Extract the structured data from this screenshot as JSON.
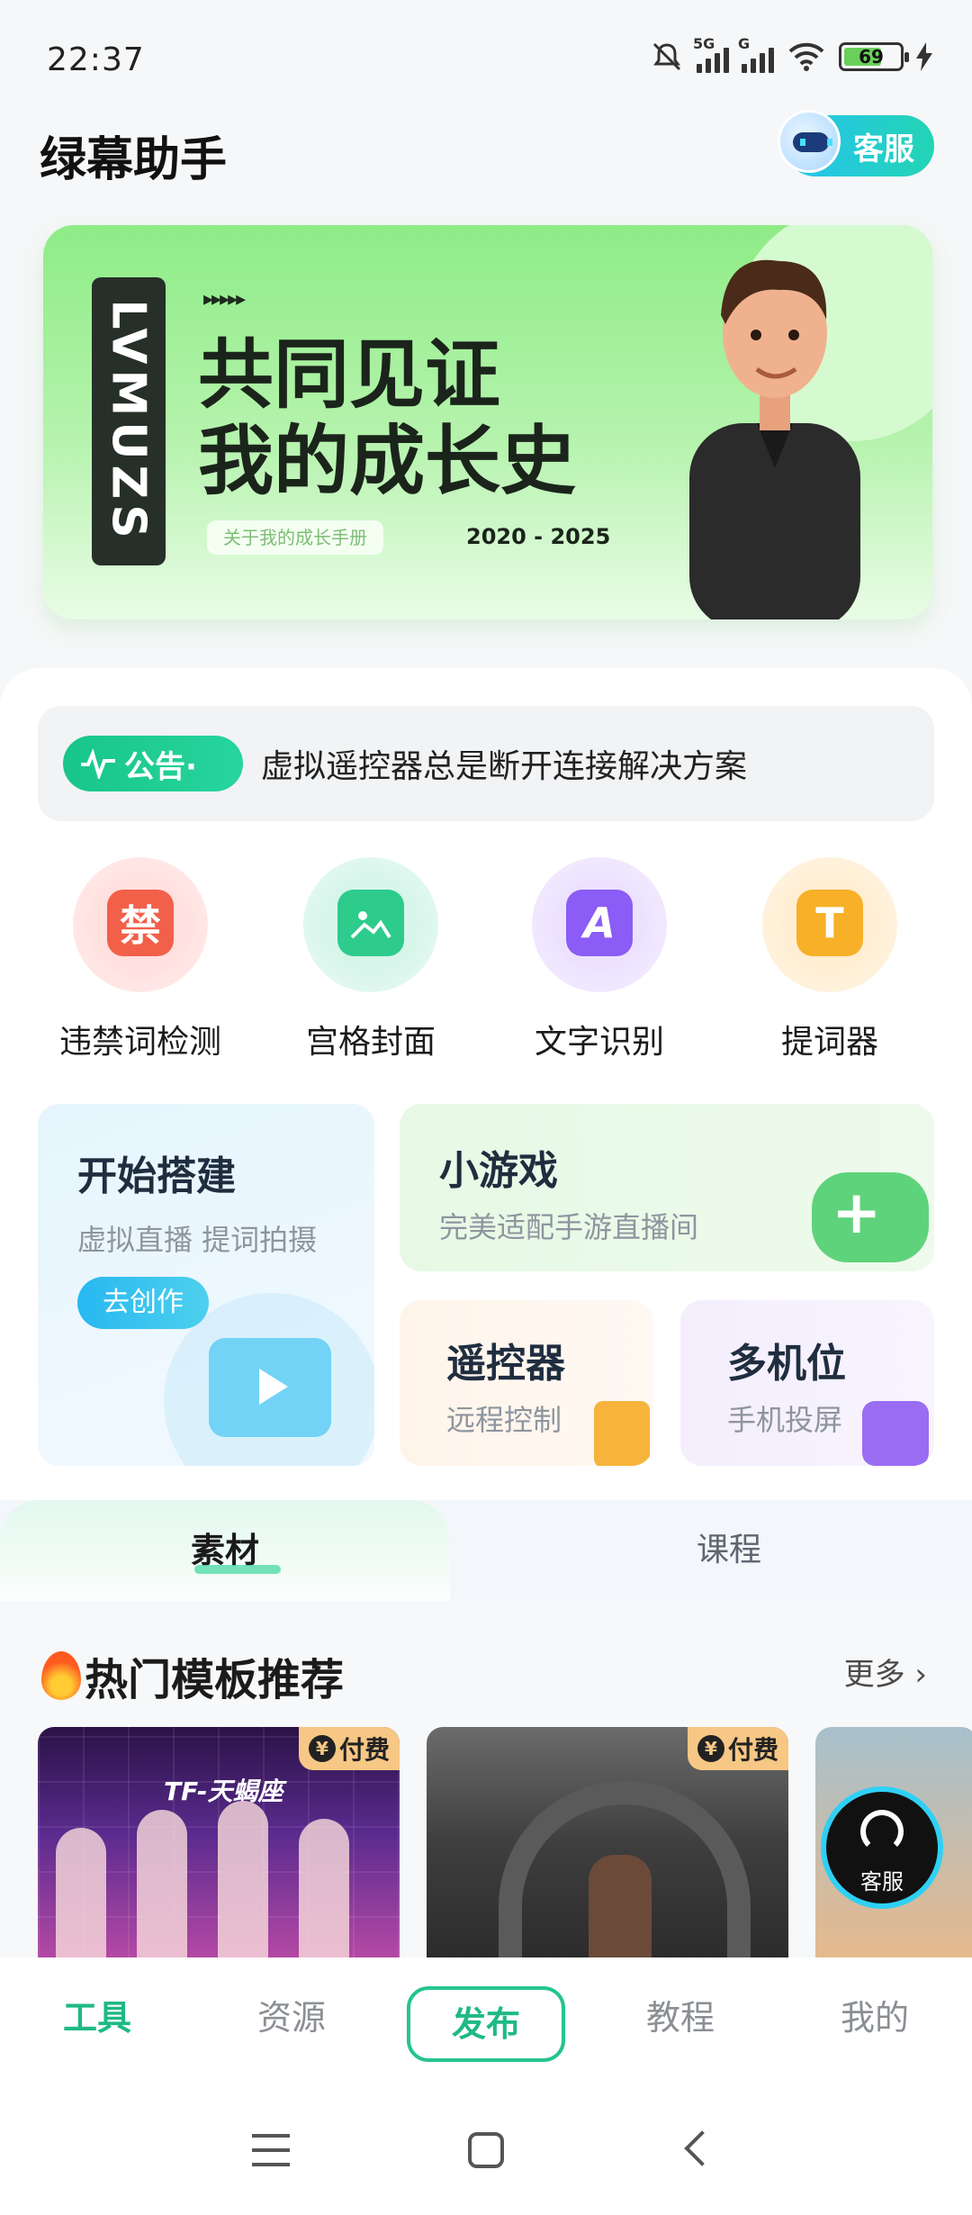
{
  "status": {
    "time": "22:37",
    "battery": "69",
    "network_label_1": "5G",
    "network_label_2": "G"
  },
  "header": {
    "title": "绿幕助手",
    "service_label": "客服"
  },
  "banner": {
    "vertical_tag": "LVMUZS",
    "arrows": "▸▸▸▸▸",
    "headline_line1": "共同见证",
    "headline_line2": "我的成长史",
    "pill": "关于我的成长手册",
    "years": "2020 - 2025"
  },
  "notice": {
    "badge": "公告·",
    "text": "虚拟遥控器总是断开连接解决方案"
  },
  "tools": [
    {
      "label": "违禁词检测",
      "glyph": "禁",
      "icon": "ban-word-icon"
    },
    {
      "label": "宫格封面",
      "glyph": "",
      "icon": "image-icon"
    },
    {
      "label": "文字识别",
      "glyph": "A",
      "icon": "text-recognition-icon"
    },
    {
      "label": "提词器",
      "glyph": "T",
      "icon": "teleprompter-icon"
    }
  ],
  "features": {
    "build": {
      "title": "开始搭建",
      "subtitle": "虚拟直播 提词拍摄",
      "button": "去创作"
    },
    "game": {
      "title": "小游戏",
      "subtitle": "完美适配手游直播间"
    },
    "remote": {
      "title": "遥控器",
      "subtitle": "远程控制"
    },
    "multi": {
      "title": "多机位",
      "subtitle": "手机投屏"
    }
  },
  "tabs": {
    "active": "素材",
    "inactive": "课程"
  },
  "hot": {
    "title": "热门模板推荐",
    "more": "更多 ›",
    "paid_label": "付费",
    "currency": "¥",
    "thumb1_logo": "TF-天蝎座"
  },
  "fab": {
    "label": "客服"
  },
  "bottom_nav": {
    "tool": "工具",
    "resource": "资源",
    "publish": "发布",
    "tutorial": "教程",
    "mine": "我的"
  },
  "colors": {
    "accent": "#1fb985",
    "banner_green": "#8eec86",
    "notice_green": "#18c58a"
  }
}
